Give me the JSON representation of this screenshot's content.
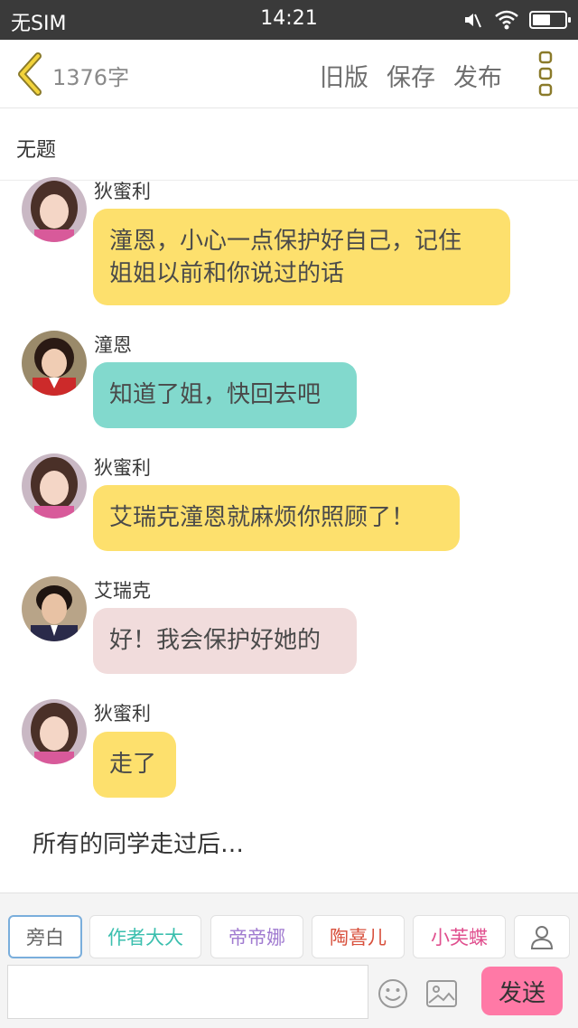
{
  "status": {
    "carrier": "无SIM",
    "time": "14:21",
    "battery_level": 0.55
  },
  "header": {
    "word_count": "1376字",
    "old_version": "旧版",
    "save": "保存",
    "publish": "发布"
  },
  "document": {
    "title": "无题"
  },
  "messages": [
    {
      "speaker": "狄蜜利",
      "text_lines": [
        "潼恩，小心一点保护好自己，记住",
        "姐姐以前和你说过的话"
      ],
      "color": "#fde06d"
    },
    {
      "speaker": "潼恩",
      "text_lines": [
        "知道了姐，快回去吧"
      ],
      "color": "#82d9cd"
    },
    {
      "speaker": "狄蜜利",
      "text_lines": [
        "艾瑞克潼恩就麻烦你照顾了！"
      ],
      "color": "#fde06d"
    },
    {
      "speaker": "艾瑞克",
      "text_lines": [
        "好！我会保护好她的"
      ],
      "color": "#f1dcdc"
    },
    {
      "speaker": "狄蜜利",
      "text_lines": [
        "走了"
      ],
      "color": "#fde06d"
    }
  ],
  "narration": "所有的同学走过后…",
  "characters": [
    {
      "label": "旁白",
      "color": "#666666"
    },
    {
      "label": "作者大大",
      "color": "#3bbfae"
    },
    {
      "label": "帝帝娜",
      "color": "#a07ad0"
    },
    {
      "label": "陶喜儿",
      "color": "#d8503c"
    },
    {
      "label": "小芙蝶",
      "color": "#e04f8e"
    }
  ],
  "input": {
    "placeholder": ""
  },
  "send_label": "发送",
  "icons": {
    "back": "chevron-left-icon",
    "menu": "vertical-dots-icon",
    "add_character": "person-icon",
    "emoji": "smiley-icon",
    "image": "image-icon",
    "mute": "mute-icon",
    "wifi": "wifi-icon",
    "battery": "battery-icon"
  },
  "colors": {
    "accent": "#f2d33b",
    "send": "#ff79a6"
  }
}
